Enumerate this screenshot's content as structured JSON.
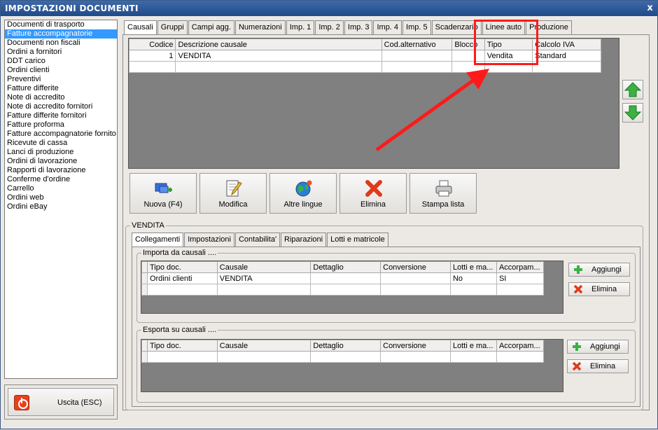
{
  "window": {
    "title": "IMPOSTAZIONI DOCUMENTI",
    "close_glyph": "x"
  },
  "documents": [
    "Documenti di trasporto",
    "Fatture accompagnatorie",
    "Documenti non fiscali",
    "Ordini a fornitori",
    "DDT carico",
    "Ordini clienti",
    "Preventivi",
    "Fatture differite",
    "Note di accredito",
    "Note di accredito fornitori",
    "Fatture differite fornitori",
    "Fatture proforma",
    "Fatture accompagnatorie fornito",
    "Ricevute di cassa",
    "Lanci di produzione",
    "Ordini di lavorazione",
    "Rapporti di lavorazione",
    "Conferme d'ordine",
    "Carrello",
    "Ordini web",
    "Ordini eBay"
  ],
  "selected_document": "Fatture accompagnatorie",
  "exit_button": {
    "label": "Uscita (ESC)",
    "icon": "power-icon"
  },
  "top_tabs": [
    "Causali",
    "Gruppi",
    "Campi agg.",
    "Numerazioni",
    "Imp. 1",
    "Imp. 2",
    "Imp. 3",
    "Imp. 4",
    "Imp. 5",
    "Scadenzario",
    "Linee auto",
    "Produzione"
  ],
  "active_top_tab": "Causali",
  "causali_grid": {
    "columns": [
      "Codice",
      "Descrizione causale",
      "Cod.alternativo",
      "Blocco",
      "Tipo",
      "Calcolo IVA"
    ],
    "rows": [
      [
        "1",
        "VENDITA",
        "",
        "",
        "Vendita",
        "Standard"
      ],
      [
        "",
        "",
        "",
        "",
        "",
        ""
      ]
    ]
  },
  "arrows": {
    "up": "arrow-up-icon",
    "down": "arrow-down-icon"
  },
  "action_buttons": [
    {
      "label": "Nuova (F4)",
      "icon": "new-document-icon"
    },
    {
      "label": "Modifica",
      "icon": "edit-icon"
    },
    {
      "label": "Altre lingue",
      "icon": "globe-icon"
    },
    {
      "label": "Elimina",
      "icon": "delete-icon"
    },
    {
      "label": "Stampa lista",
      "icon": "printer-icon"
    }
  ],
  "detail": {
    "title": "VENDITA",
    "tabs": [
      "Collegamenti",
      "Impostazioni",
      "Contabilita'",
      "Riparazioni",
      "Lotti e matricole"
    ],
    "active_tab": "Collegamenti",
    "import_group": {
      "title": "Importa da causali ....",
      "columns": [
        "Tipo doc.",
        "Causale",
        "Dettaglio",
        "Conversione",
        "Lotti e ma...",
        "Accorpam..."
      ],
      "rows": [
        [
          "Ordini clienti",
          "VENDITA",
          "",
          "",
          "No",
          "SI"
        ],
        [
          "",
          "",
          "",
          "",
          "",
          ""
        ]
      ],
      "add_label": "Aggiungi",
      "delete_label": "Elimina"
    },
    "export_group": {
      "title": "Esporta su causali ....",
      "columns": [
        "Tipo doc.",
        "Causale",
        "Dettaglio",
        "Conversione",
        "Lotti e ma...",
        "Accorpam..."
      ],
      "rows": [
        [
          "",
          "",
          "",
          "",
          "",
          ""
        ]
      ],
      "add_label": "Aggiungi",
      "delete_label": "Elimina"
    }
  },
  "colors": {
    "titlebar": "#2a5594",
    "selection": "#3399ff",
    "callout": "#ff1a1a",
    "grid_empty": "#808080"
  }
}
